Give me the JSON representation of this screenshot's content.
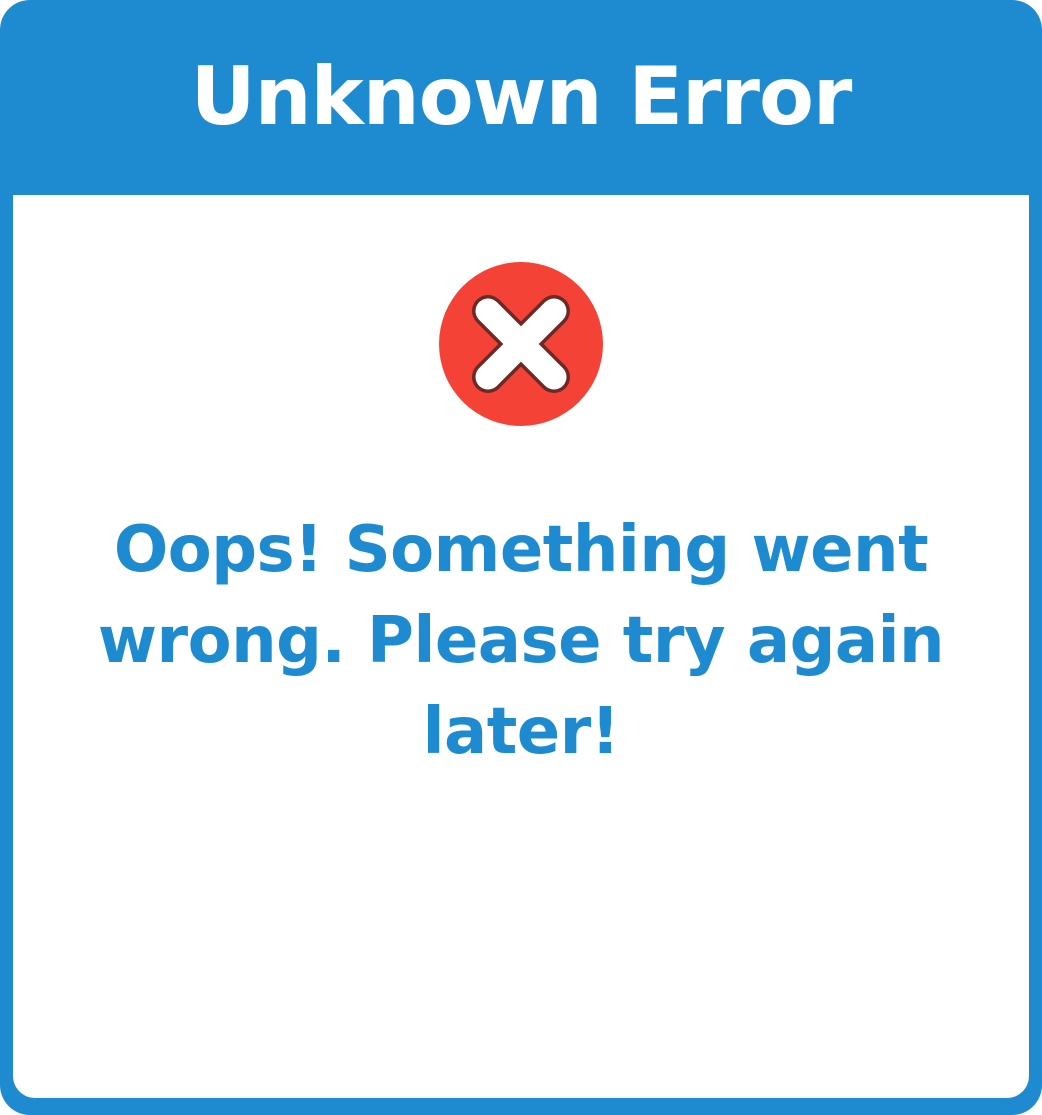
{
  "dialog": {
    "title": "Unknown Error",
    "icon": "error-x-circle-icon",
    "message": "Oops! Something went wrong. Please try again later!"
  },
  "colors": {
    "frame": "#1e8bd1",
    "background": "#ffffff",
    "title_text": "#ffffff",
    "message_text": "#1e8bd1",
    "error_circle": "#f44336",
    "error_cross": "#ffffff"
  }
}
